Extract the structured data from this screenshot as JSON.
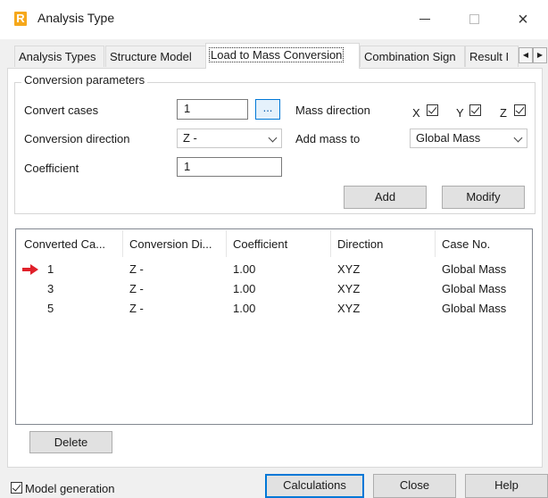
{
  "window": {
    "title": "Analysis Type",
    "app_icon_letter": "R",
    "controls": {
      "minimize": "minimize",
      "maximize": "maximize",
      "close": "×"
    }
  },
  "tabs": [
    {
      "label": "Analysis Types",
      "active": false
    },
    {
      "label": "Structure Model",
      "active": false
    },
    {
      "label": "Load to Mass Conversion",
      "active": true
    },
    {
      "label": "Combination Sign",
      "active": false
    },
    {
      "label": "Result I",
      "active": false
    }
  ],
  "tab_scroll": {
    "left": "◀",
    "right": "▶"
  },
  "conversion": {
    "group_title": "Conversion parameters",
    "convert_cases_label": "Convert cases",
    "convert_cases_value": "1",
    "browse_label": "...",
    "mass_direction_label": "Mass direction",
    "mass_direction": [
      {
        "axis": "X",
        "checked": true
      },
      {
        "axis": "Y",
        "checked": true
      },
      {
        "axis": "Z",
        "checked": true
      }
    ],
    "direction_label": "Conversion direction",
    "direction_value": "Z -",
    "add_mass_to_label": "Add mass to",
    "add_mass_to_value": "Global Mass",
    "coefficient_label": "Coefficient",
    "coefficient_value": "1",
    "add_button": "Add",
    "modify_button": "Modify"
  },
  "list": {
    "columns": [
      "Converted Ca...",
      "Conversion Di...",
      "Coefficient",
      "Direction",
      "Case No."
    ],
    "rows": [
      {
        "case": "1",
        "direction": "Z -",
        "coefficient": "1.00",
        "mass_direction": "XYZ",
        "target": "Global Mass",
        "current": true
      },
      {
        "case": "3",
        "direction": "Z -",
        "coefficient": "1.00",
        "mass_direction": "XYZ",
        "target": "Global Mass",
        "current": false
      },
      {
        "case": "5",
        "direction": "Z -",
        "coefficient": "1.00",
        "mass_direction": "XYZ",
        "target": "Global Mass",
        "current": false
      }
    ],
    "delete_button": "Delete"
  },
  "footer": {
    "model_generation_label": "Model generation",
    "model_generation_checked": true,
    "calculations_button": "Calculations",
    "close_button": "Close",
    "help_button": "Help"
  },
  "colors": {
    "accent": "#0078d7",
    "arrow_red": "#e0202a",
    "app_icon": "#f6a81b"
  }
}
